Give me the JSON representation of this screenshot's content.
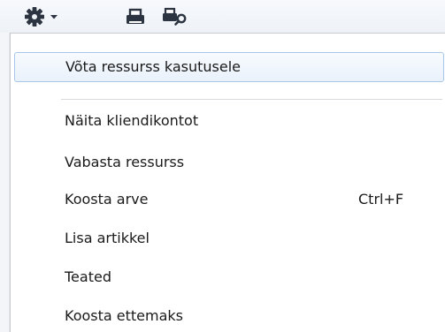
{
  "toolbar": {
    "buttons": [
      {
        "icon": "gear-dropdown-icon"
      },
      {
        "icon": "printer-icon"
      },
      {
        "icon": "print-preview-icon"
      }
    ]
  },
  "menu": {
    "items": [
      {
        "label": "Võta ressurss kasutusele",
        "shortcut": "",
        "highlighted": true
      },
      {
        "label": "Näita kliendikontot",
        "shortcut": ""
      },
      {
        "label": "Vabasta ressurss",
        "shortcut": ""
      },
      {
        "label": "Koosta arve",
        "shortcut": "Ctrl+F"
      },
      {
        "label": "Lisa artikkel",
        "shortcut": ""
      },
      {
        "label": "Teated",
        "shortcut": ""
      },
      {
        "label": "Koosta ettemaks",
        "shortcut": ""
      }
    ]
  },
  "colors": {
    "highlight_border": "#a9c6ea",
    "icon_dark": "#2b3440"
  }
}
